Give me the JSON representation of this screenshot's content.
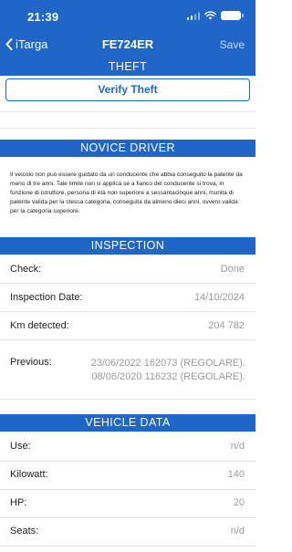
{
  "status": {
    "time": "21:39"
  },
  "nav": {
    "back_label": "iTarga",
    "title": "FE724ER",
    "save_label": "Save"
  },
  "theft": {
    "header": "THEFT",
    "verify_label": "Verify Theft"
  },
  "novice": {
    "header": "NOVICE DRIVER",
    "text": "Il veicolo non può essere guidato da un conducente che abbia conseguito la patente da meno di tre anni. Tale limite non si applica se a fianco del conducente si trova, in funzione di istruttore, persona di età non superiore a sessantacinque anni, munita di patente valida per la stessa categoria, conseguita da almeno dieci anni, ovvero valida per la categoria superiore."
  },
  "inspection": {
    "header": "INSPECTION",
    "check_label": "Check:",
    "check_value": "Done",
    "date_label": "Inspection Date:",
    "date_value": "14/10/2024",
    "km_label": "Km detected:",
    "km_value": "204 782",
    "previous_label": "Previous:",
    "previous": [
      "23/06/2022 162073 (REGOLARE).",
      "08/06/2020 116232 (REGOLARE)."
    ]
  },
  "vehicle": {
    "header": "VEHICLE DATA",
    "rows": [
      {
        "label": "Use:",
        "value": "n/d"
      },
      {
        "label": "Kilowatt:",
        "value": "140"
      },
      {
        "label": "HP:",
        "value": "20"
      },
      {
        "label": "Seats:",
        "value": "n/d"
      }
    ]
  }
}
